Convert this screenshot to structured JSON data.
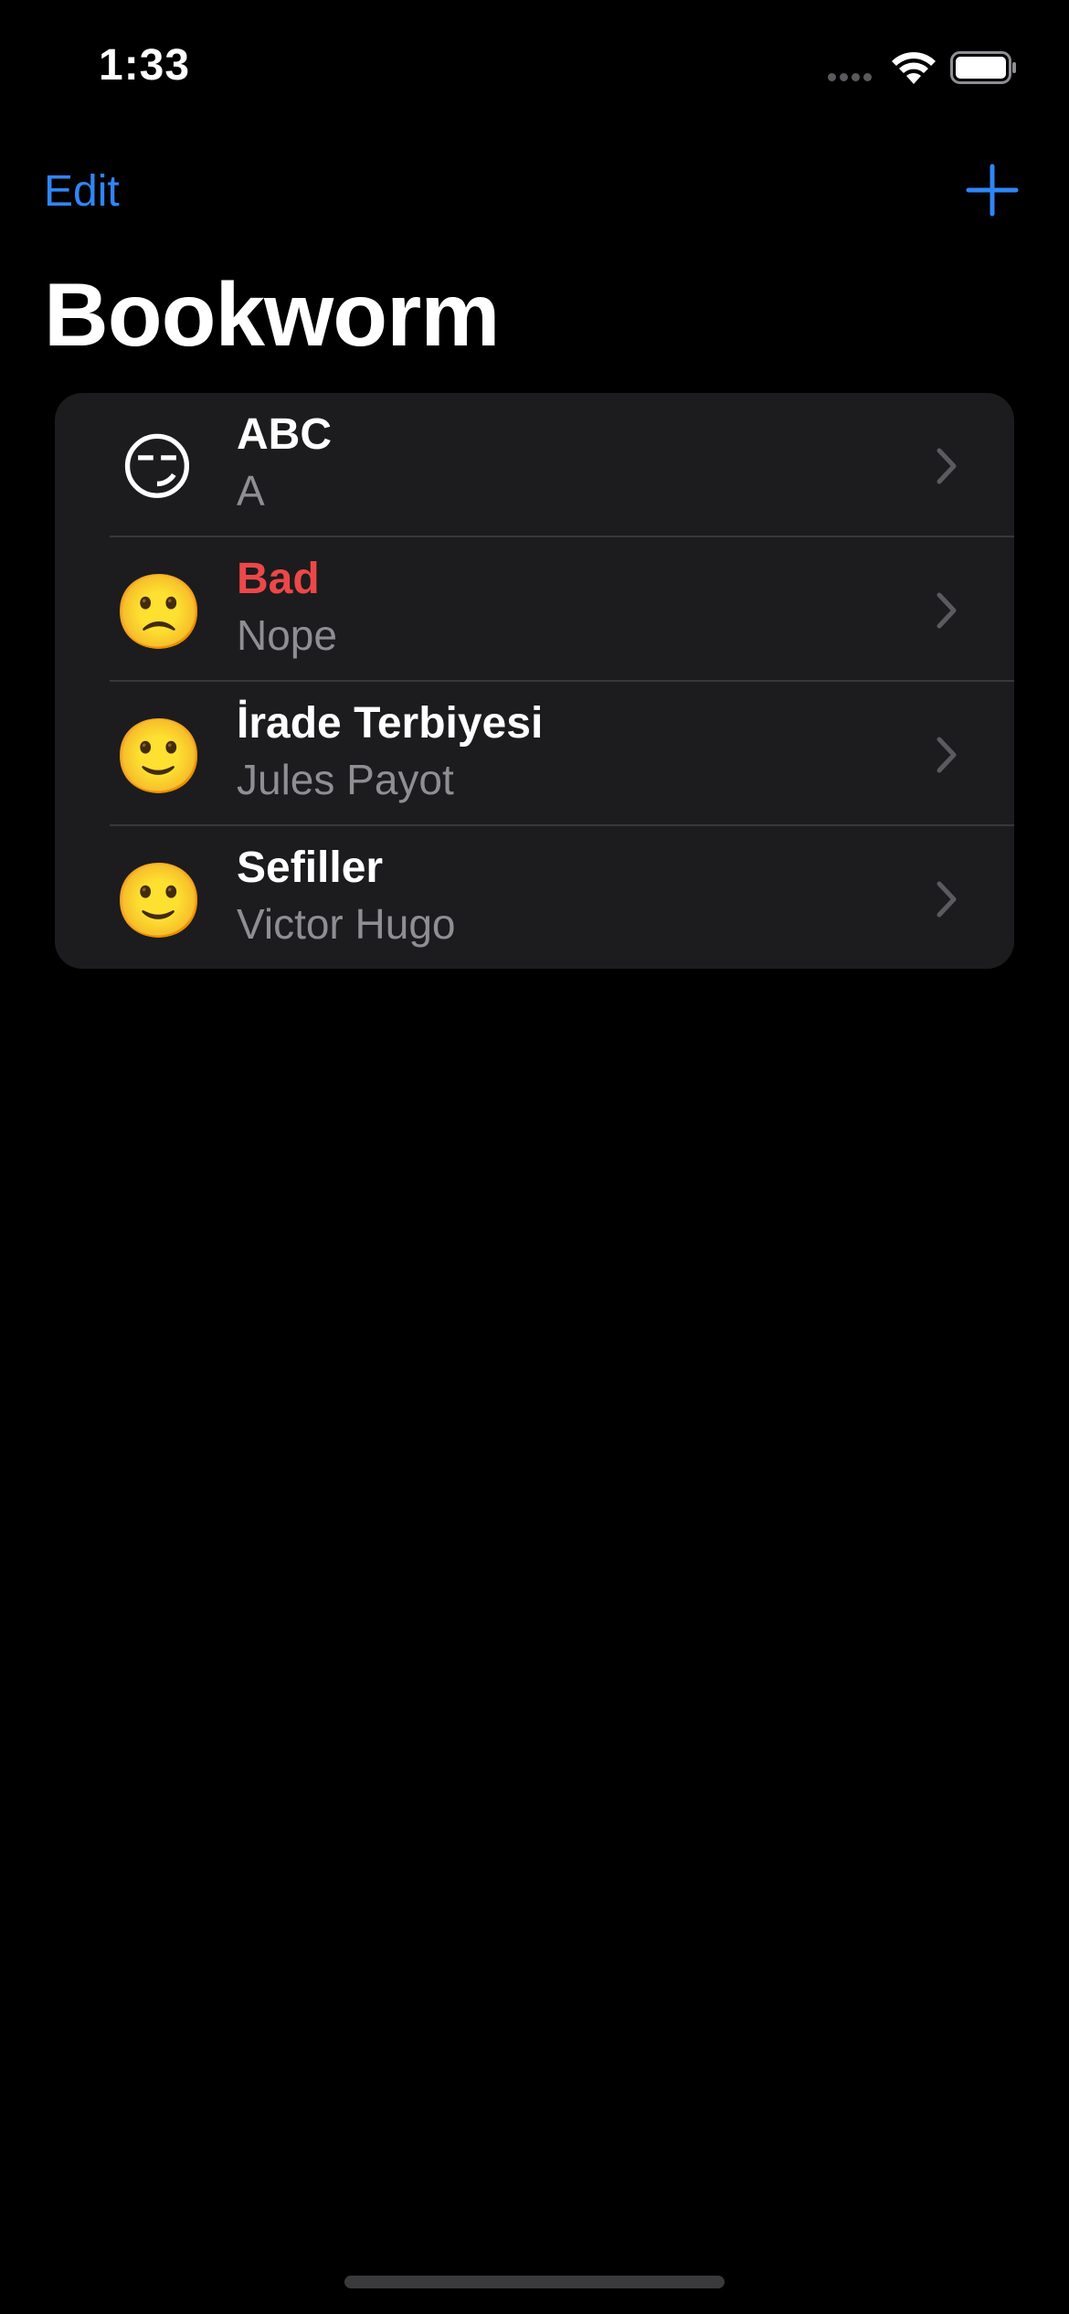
{
  "status_bar": {
    "time": "1:33"
  },
  "nav": {
    "edit_label": "Edit",
    "add_icon": "plus-icon",
    "title": "Bookworm"
  },
  "colors": {
    "accent": "#2f86f6",
    "destructive": "#ec4848",
    "background": "#000000",
    "cell": "#1c1c1e",
    "secondary_text": "#8e8e93"
  },
  "books": [
    {
      "emoji": "😏",
      "title": "ABC",
      "author": "A",
      "rating_style": "normal"
    },
    {
      "emoji": "🙁",
      "title": "Bad",
      "author": "Nope",
      "rating_style": "bad"
    },
    {
      "emoji": "🙂",
      "title": "İrade Terbiyesi",
      "author": "Jules Payot",
      "rating_style": "normal"
    },
    {
      "emoji": "🙂",
      "title": "Sefiller",
      "author": "Victor Hugo",
      "rating_style": "normal"
    }
  ]
}
